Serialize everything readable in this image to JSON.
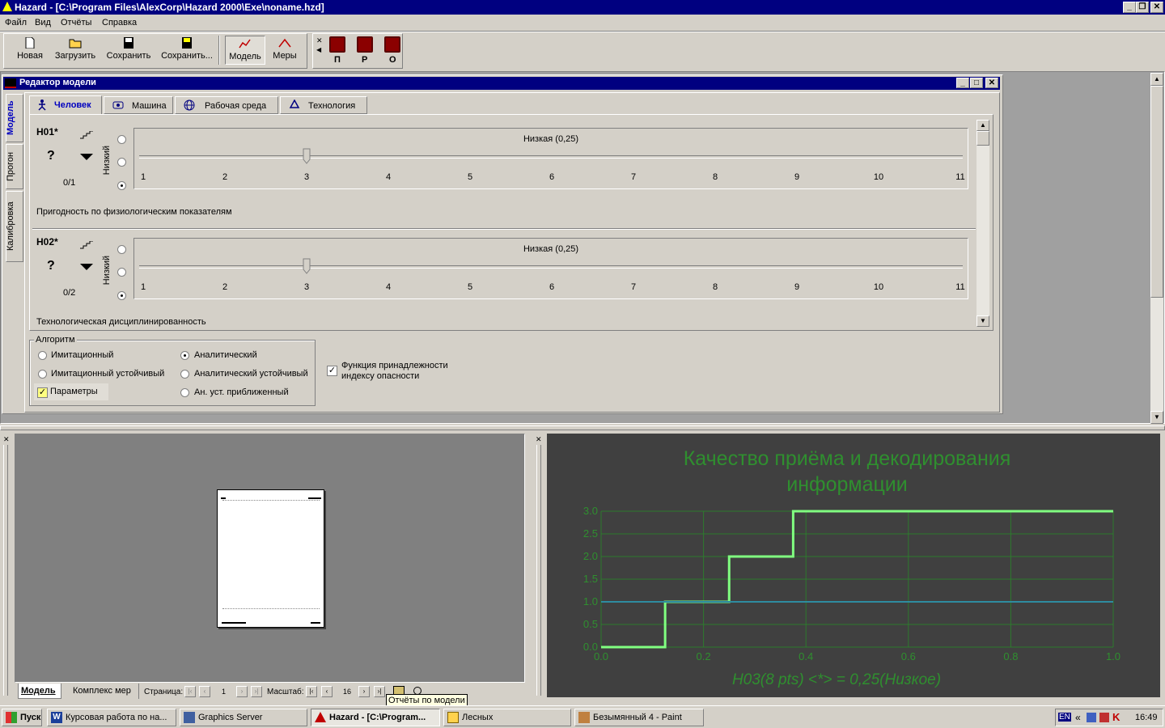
{
  "window": {
    "title": "Hazard - [C:\\Program Files\\AlexCorp\\Hazard 2000\\Exe\\noname.hzd]"
  },
  "menu": [
    "Файл",
    "Вид",
    "Отчёты",
    "Справка"
  ],
  "toolbar": {
    "new": "Новая",
    "load": "Загрузить",
    "save": "Сохранить",
    "save_as": "Сохранить...",
    "model": "Модель",
    "measures": "Меры",
    "indicators": [
      "П",
      "Р",
      "О"
    ]
  },
  "editor": {
    "title": "Редактор модели",
    "side_tabs": [
      "Модель",
      "Прогон",
      "Калибровка"
    ],
    "tabs": [
      "Человек",
      "Машина",
      "Рабочая среда",
      "Технология"
    ],
    "radio_axis_label": "Низкий",
    "items": [
      {
        "id": "Н01*",
        "counter": "0/1",
        "level_label": "Низкая (0,25)",
        "description": "Пригодность по физиологическим показателям",
        "value": 3,
        "ticks": [
          "1",
          "2",
          "3",
          "4",
          "5",
          "6",
          "7",
          "8",
          "9",
          "10",
          "11"
        ]
      },
      {
        "id": "Н02*",
        "counter": "0/2",
        "level_label": "Низкая (0,25)",
        "description": "Технологическая дисциплинированность",
        "value": 3,
        "ticks": [
          "1",
          "2",
          "3",
          "4",
          "5",
          "6",
          "7",
          "8",
          "9",
          "10",
          "11"
        ]
      }
    ],
    "algorithm": {
      "legend": "Алгоритм",
      "options_left": [
        "Имитационный",
        "Имитационный устойчивый"
      ],
      "options_right": [
        "Аналитический",
        "Аналитический устойчивый",
        "Ан. уст. приближенный"
      ],
      "selected": "Аналитический",
      "params_label": "Параметры",
      "membership_line1": "Функция принадлежности",
      "membership_line2": "индексу опасности"
    }
  },
  "report_pane": {
    "tabs": [
      "Модель",
      "Комплекс мер"
    ],
    "page_label": "Страница:",
    "page_value": "1",
    "scale_label": "Масштаб:",
    "scale_value": "16",
    "tooltip": "Отчёты по модели"
  },
  "chart_data": {
    "type": "line",
    "title_line1": "Качество приёма и декодирования",
    "title_line2": "информации",
    "footer": "Н03(8 pts) <*> = 0,25(Низкое)",
    "xlim": [
      0.0,
      1.0
    ],
    "ylim": [
      0.0,
      3.0
    ],
    "x_ticks": [
      "0.0",
      "0.2",
      "0.4",
      "0.6",
      "0.8",
      "1.0"
    ],
    "y_ticks": [
      "0.0",
      "0.5",
      "1.0",
      "1.5",
      "2.0",
      "2.5",
      "3.0"
    ],
    "grid": true,
    "series": [
      {
        "color": "#80ff80",
        "x": [
          0.0,
          0.125,
          0.125,
          0.25,
          0.25,
          0.375,
          0.375,
          1.0
        ],
        "y": [
          0,
          0,
          1,
          1,
          2,
          2,
          3,
          3
        ]
      },
      {
        "color": "#2e8ca0",
        "x": [
          0.0,
          1.0
        ],
        "y": [
          1,
          1
        ]
      }
    ],
    "colors": {
      "background": "#404040",
      "grid": "#2d7a2d",
      "text": "#2f8f2f"
    }
  },
  "taskbar": {
    "start": "Пуск",
    "tasks": [
      "Курсовая работа по на...",
      "Graphics Server",
      "Hazard - [C:\\Program...",
      "Лесных",
      "Безымянный 4 - Paint"
    ],
    "lang": "EN",
    "clock": "16:49"
  }
}
